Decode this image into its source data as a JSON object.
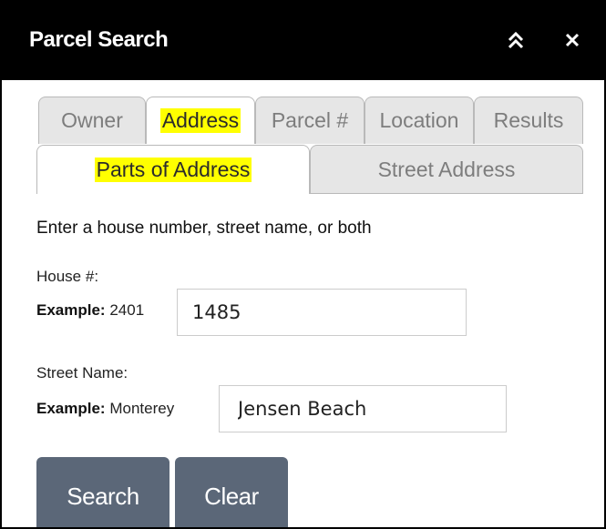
{
  "panel": {
    "title": "Parcel Search",
    "collapse_icon": "double-chevron-up-icon",
    "close_icon": "close-icon"
  },
  "tabs": [
    {
      "label": "Owner",
      "active": false
    },
    {
      "label": "Address",
      "active": true,
      "highlighted": true
    },
    {
      "label": "Parcel #",
      "active": false
    },
    {
      "label": "Location",
      "active": false
    },
    {
      "label": "Results",
      "active": false
    }
  ],
  "subtabs": [
    {
      "label": "Parts of Address",
      "active": true,
      "highlighted": true
    },
    {
      "label": "Street Address",
      "active": false
    }
  ],
  "form": {
    "instruction": "Enter a house number, street name, or both",
    "house": {
      "label": "House #:",
      "example_prefix": "Example:",
      "example_value": "2401",
      "value": "1485"
    },
    "street": {
      "label": "Street Name:",
      "example_prefix": "Example:",
      "example_value": "Monterey",
      "value": "Jensen Beach"
    }
  },
  "buttons": {
    "search": "Search",
    "clear": "Clear"
  },
  "colors": {
    "titlebar": "#000000",
    "highlight": "#ffff00",
    "button": "#5b6778",
    "inactive_tab": "#e6e6e6"
  }
}
